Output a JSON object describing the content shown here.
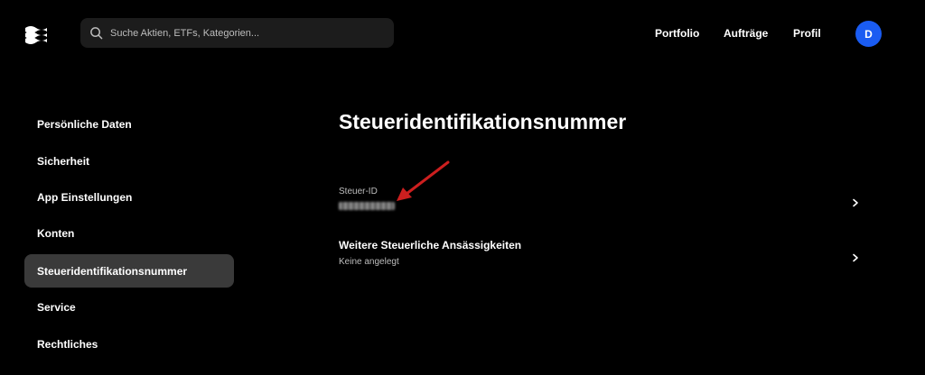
{
  "header": {
    "search_placeholder": "Suche Aktien, ETFs, Kategorien...",
    "nav": {
      "portfolio": "Portfolio",
      "auftraege": "Aufträge",
      "profil": "Profil"
    },
    "avatar_initial": "D",
    "avatar_color": "#1a5cf2"
  },
  "sidebar": {
    "items": [
      {
        "label": "Persönliche Daten",
        "active": false
      },
      {
        "label": "Sicherheit",
        "active": false
      },
      {
        "label": "App Einstellungen",
        "active": false
      },
      {
        "label": "Konten",
        "active": false
      },
      {
        "label": "Steueridentifikationsnummer",
        "active": true
      },
      {
        "label": "Service",
        "active": false
      },
      {
        "label": "Rechtliches",
        "active": false
      }
    ]
  },
  "main": {
    "title": "Steueridentifikationsnummer",
    "steuer_id": {
      "label": "Steuer-ID",
      "value_masked": true
    },
    "weitere": {
      "title": "Weitere Steuerliche Ansässigkeiten",
      "subtitle": "Keine angelegt"
    }
  },
  "icons": {
    "logo": "logo-icon",
    "search": "search-icon",
    "chevron": "chevron-right-icon",
    "annotation": "red-arrow-icon"
  },
  "colors": {
    "background": "#000000",
    "active_item": "#3a3a3a",
    "search_bg": "#1c1c1c",
    "annotation_red": "#cc1f1f"
  }
}
